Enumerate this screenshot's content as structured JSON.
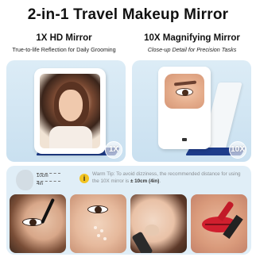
{
  "title": "2-in-1 Travel Makeup Mirror",
  "left": {
    "heading": "1X HD Mirror",
    "subheading": "True-to-life Reflection for Daily Grooming",
    "badge": "1X"
  },
  "right": {
    "heading": "10X Magnifying Mirror",
    "subheading": "Close-up Detail for Precision Tasks",
    "badge": "10X"
  },
  "distance": {
    "label_1": "10cm",
    "label_2": "4in"
  },
  "tip": {
    "icon": "i",
    "text_before": "Warm Tip: To avoid dizziness, the recommended distance for using the 10X mirror is ",
    "emphasis": "± 10cm (4in)",
    "text_after": "."
  },
  "colors": {
    "panel_bg": "#d3e6f3",
    "tray_navy": "#1e3c8a",
    "bottom_bg": "#e0eef7",
    "tip_yellow": "#f3c422"
  }
}
